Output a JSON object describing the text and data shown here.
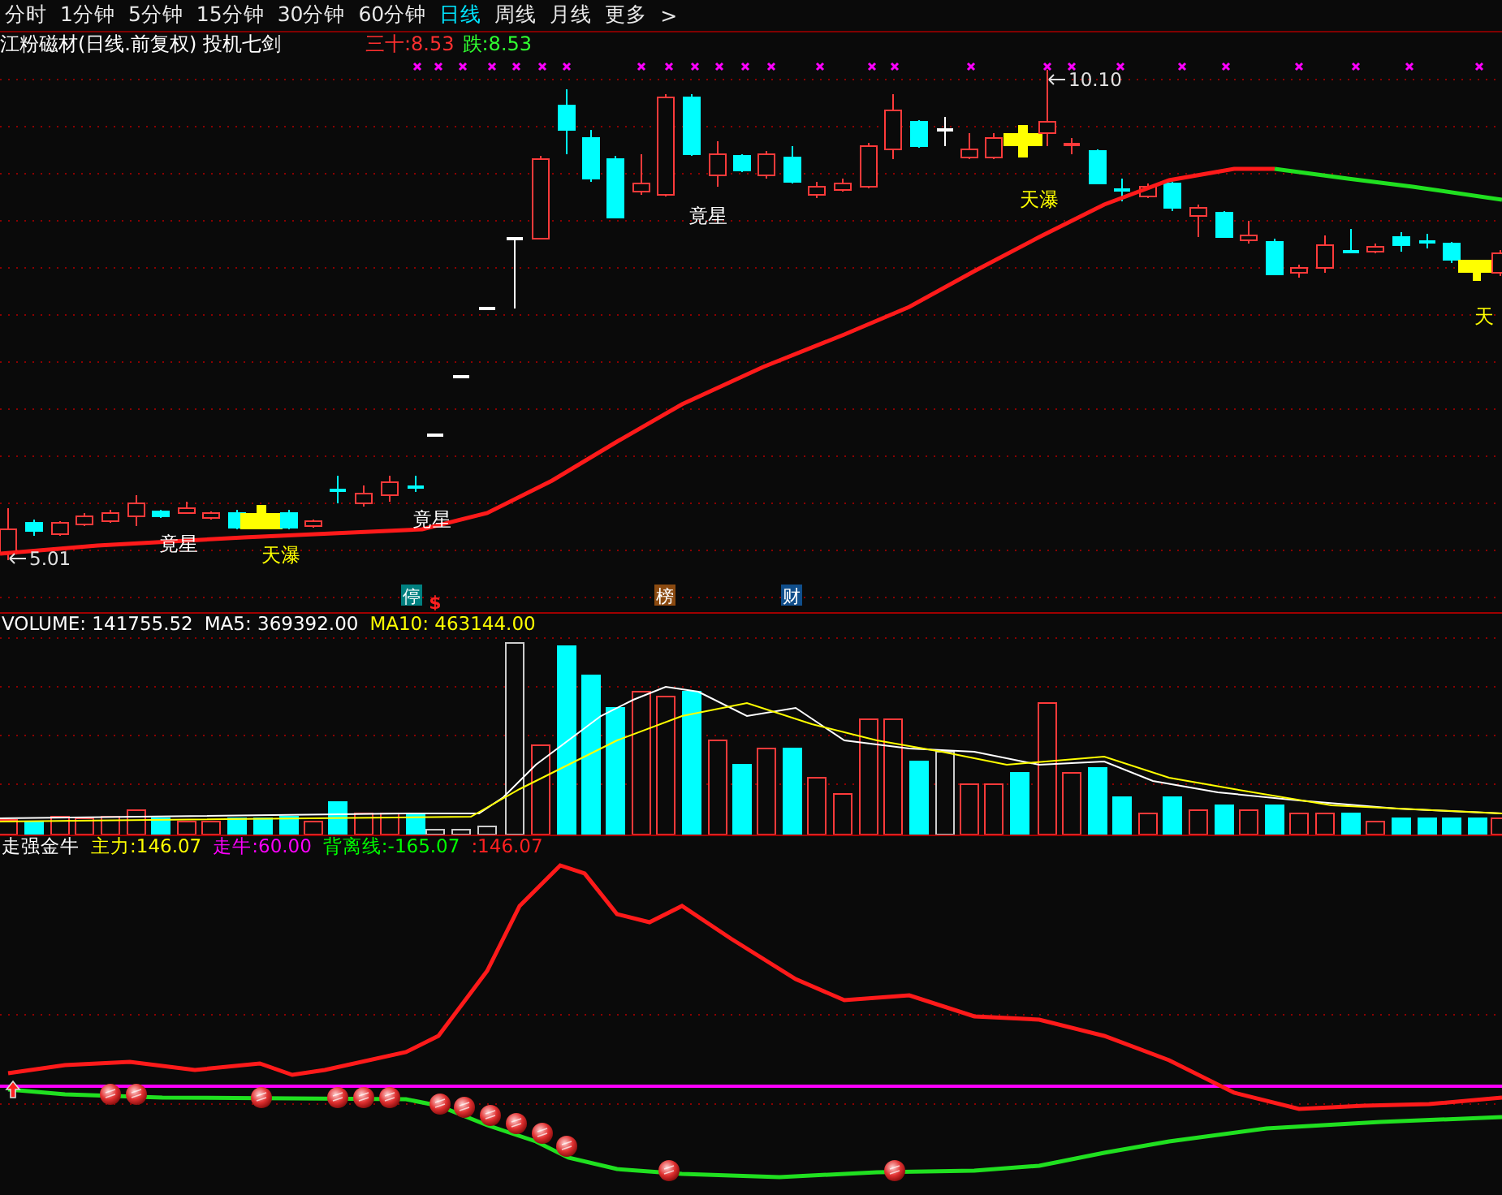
{
  "toolbar": {
    "periods": [
      {
        "label": "分时",
        "selected": false
      },
      {
        "label": "1分钟",
        "selected": false
      },
      {
        "label": "5分钟",
        "selected": false
      },
      {
        "label": "15分钟",
        "selected": false
      },
      {
        "label": "30分钟",
        "selected": false
      },
      {
        "label": "60分钟",
        "selected": false
      },
      {
        "label": "日线",
        "selected": true
      },
      {
        "label": "周线",
        "selected": false
      },
      {
        "label": "月线",
        "selected": false
      },
      {
        "label": "更多",
        "selected": false
      }
    ],
    "more_arrow": ">"
  },
  "price_chart": {
    "title": "江粉磁材(日线.前复权) 投机七剑",
    "legend": [
      {
        "text": "三十:8.53",
        "color": "#ff3030"
      },
      {
        "text": "跌:8.53",
        "color": "#30ff30"
      }
    ],
    "annotations": [
      {
        "kind": "label",
        "text": "竟星",
        "color": "#ffffff"
      },
      {
        "kind": "label",
        "text": "天瀑",
        "color": "#ffff00"
      },
      {
        "kind": "label",
        "text": "竟星",
        "color": "#ffffff"
      },
      {
        "kind": "label",
        "text": "竟星",
        "color": "#ffffff"
      },
      {
        "kind": "label",
        "text": "天瀑",
        "color": "#ffff00"
      },
      {
        "kind": "label",
        "text": "天",
        "color": "#ffff00"
      },
      {
        "kind": "price",
        "text": "10.10",
        "color": "#e0e0e0"
      },
      {
        "kind": "price",
        "text": "5.01",
        "color": "#e0e0e0"
      }
    ],
    "signals": [
      {
        "kind": "badge",
        "text": "停",
        "color": "#008080"
      },
      {
        "kind": "glyph",
        "text": "$",
        "color": "#ff2020"
      },
      {
        "kind": "badge",
        "text": "榜",
        "color": "#8b4a10"
      },
      {
        "kind": "badge",
        "text": "财",
        "color": "#104e8b"
      }
    ]
  },
  "volume_chart": {
    "legend": [
      {
        "text": "VOLUME: 141755.52",
        "color": "#ffffff"
      },
      {
        "text": "MA5: 369392.00",
        "color": "#ffffff"
      },
      {
        "text": "MA10: 463144.00",
        "color": "#ffff00"
      }
    ]
  },
  "indicator_chart": {
    "legend": [
      {
        "text": "走强金牛",
        "color": "#ffffff"
      },
      {
        "text": "主力:146.07",
        "color": "#ffff00"
      },
      {
        "text": "走牛:60.00",
        "color": "#ff00ff"
      },
      {
        "text": "背离线:-165.07",
        "color": "#00ff00"
      },
      {
        "text": ":146.07",
        "color": "#ff2020"
      }
    ]
  }
}
